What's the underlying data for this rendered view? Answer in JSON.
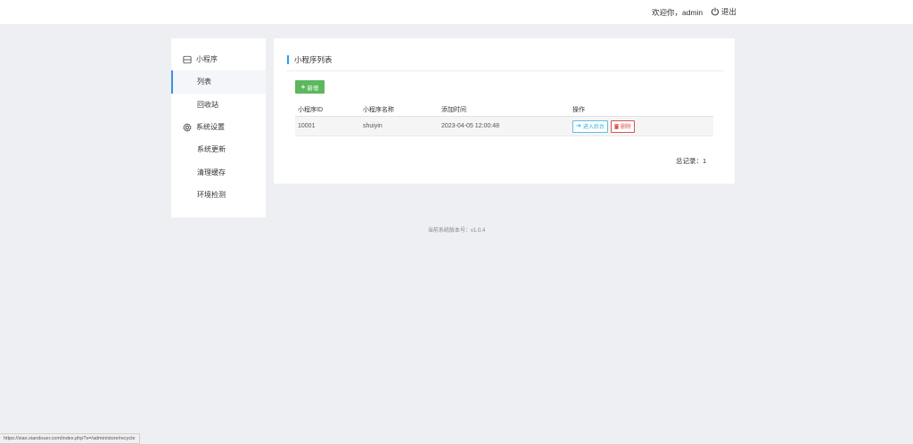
{
  "header": {
    "welcome": "欢迎你，admin",
    "logout_label": "退出"
  },
  "sidebar": {
    "groups": [
      {
        "label": "小程序",
        "icon": "miniapp-icon",
        "items": [
          {
            "label": "列表",
            "active": true
          },
          {
            "label": "回收站",
            "active": false
          }
        ]
      },
      {
        "label": "系统设置",
        "icon": "gear-icon",
        "items": [
          {
            "label": "系统更新",
            "active": false
          },
          {
            "label": "清理缓存",
            "active": false
          },
          {
            "label": "环境检测",
            "active": false
          }
        ]
      }
    ]
  },
  "main": {
    "title": "小程序列表",
    "add_button": "新增",
    "table": {
      "columns": [
        "小程序ID",
        "小程序名称",
        "添加时间",
        "操作"
      ],
      "rows": [
        {
          "id": "10001",
          "name": "shuiyin",
          "time": "2023-04-05 12:00:48",
          "enter": "进入后台",
          "delete": "删除"
        }
      ]
    },
    "total": "总记录：1"
  },
  "footer": {
    "version": "当前系统版本号：v1.0.4"
  },
  "status_bar": {
    "url": "https://xiao.xiandouer.com/index.php?s=/admin/store/recycle"
  },
  "colors": {
    "accent": "#1e9fff",
    "success": "#5cb85c",
    "info": "#5bc0de",
    "danger": "#d9534f",
    "background": "#eeeff3"
  }
}
